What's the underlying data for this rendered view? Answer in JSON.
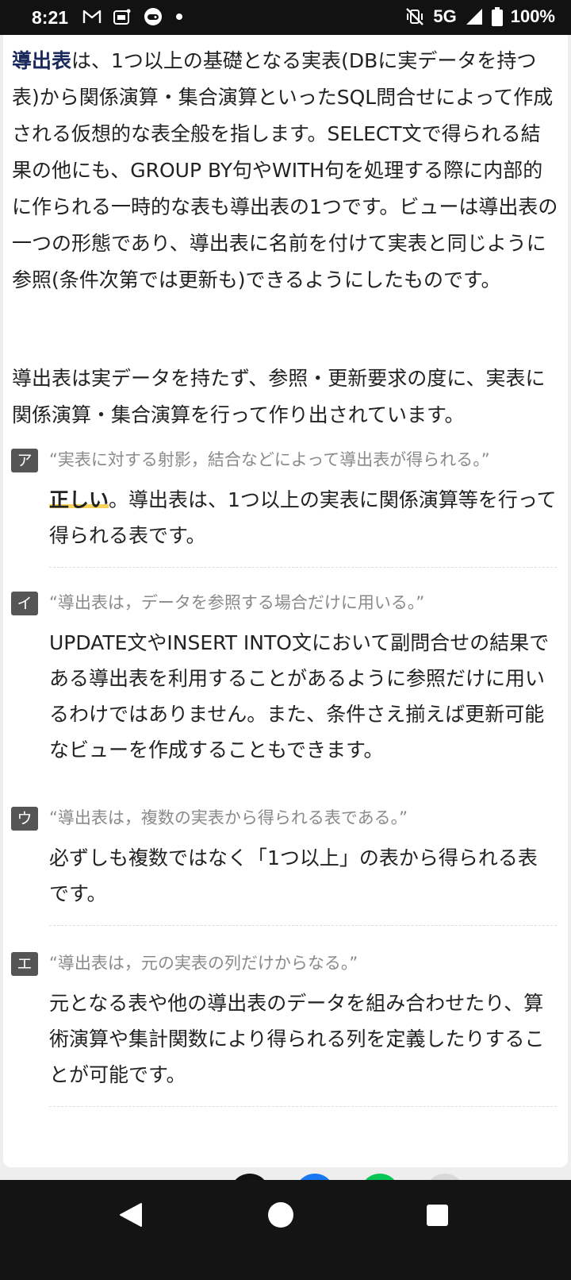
{
  "status_bar": {
    "time": "8:21",
    "left_icons": [
      "gmail-icon",
      "app-icon",
      "game-icon",
      "dot-icon"
    ],
    "network": "5G",
    "battery": "100%"
  },
  "intro": {
    "term": "導出表",
    "p1_rest": "は、1つ以上の基礎となる実表(DBに実データを持つ表)から関係演算・集合演算といったSQL問合せによって作成される仮想的な表全般を指します。SELECT文で得られる結果の他にも、GROUP BY句やWITH句を処理する際に内部的に作られる一時的な表も導出表の1つです。ビューは導出表の一つの形態であり、導出表に名前を付けて実表と同じように参照(条件次第では更新も)できるようにしたものです。",
    "p2": "導出表は実データを持たず、参照・更新要求の度に、実表に関係演算・集合演算を行って作り出されています。"
  },
  "items": [
    {
      "badge": "ア",
      "question": "“実表に対する射影，結合などによって導出表が得られる。”",
      "verdict": "正しい",
      "answer": "。導出表は、1つ以上の実表に関係演算等を行って得られる表です。"
    },
    {
      "badge": "イ",
      "question": "“導出表は，データを参照する場合だけに用いる。”",
      "answer": "UPDATE文やINSERT INTO文において副問合せの結果である導出表を利用することがあるように参照だけに用いるわけではありません。また、条件さえ揃えば更新可能なビューを作成することもできます。"
    },
    {
      "badge": "ウ",
      "question": "“導出表は，複数の実表から得られる表である。”",
      "answer": "必ずしも複数ではなく「1つ以上」の表から得られる表です。"
    },
    {
      "badge": "エ",
      "question": "“導出表は，元の実表の列だけからなる。”",
      "answer": "元となる表や他の導出表のデータを組み合わせたり、算術演算や集計関数により得られる列を定義したりすることが可能です。"
    }
  ],
  "share_colors": [
    "#111111",
    "#1877f2",
    "#06c755",
    "#d8d8d8"
  ]
}
